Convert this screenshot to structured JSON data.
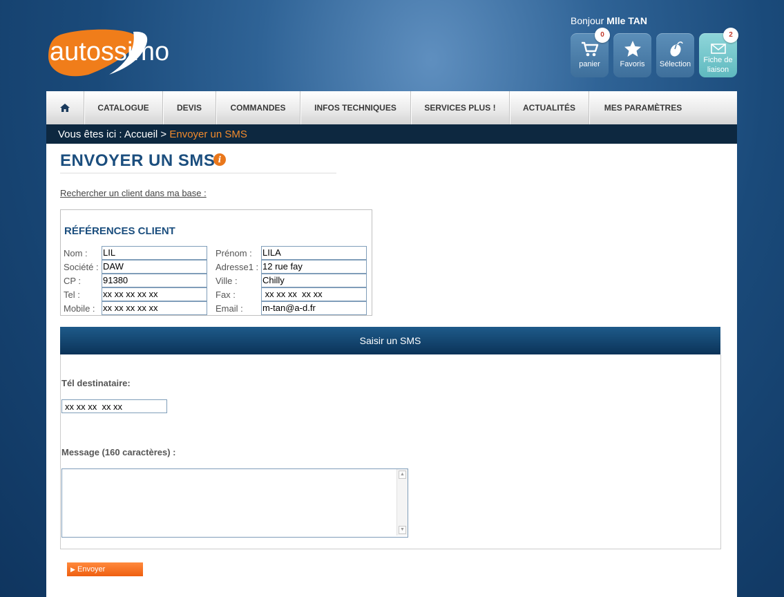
{
  "brand": {
    "logo_text": "autossimo",
    "logo_color": "#f07d1a"
  },
  "header": {
    "greeting_prefix": "Bonjour",
    "user_name": "Mlle TAN",
    "buttons": [
      {
        "label": "panier",
        "icon": "cart-icon",
        "badge": "0"
      },
      {
        "label": "Favoris",
        "icon": "star-icon"
      },
      {
        "label": "Sélection",
        "icon": "mouse-icon"
      },
      {
        "label": "Fiche de liaison",
        "icon": "envelope-icon",
        "badge": "2"
      }
    ]
  },
  "nav": {
    "home_icon": "home-icon",
    "items": [
      "CATALOGUE",
      "DEVIS",
      "COMMANDES",
      "INFOS TECHNIQUES",
      "SERVICES PLUS !",
      "ACTUALITÉS",
      "MES PARAMÈTRES"
    ]
  },
  "breadcrumb": {
    "prefix": "Vous êtes ici : Accueil >",
    "current": "Envoyer un SMS"
  },
  "page": {
    "title": "ENVOYER UN SMS",
    "info_icon": "info-icon",
    "search_link": "Rechercher un client dans ma base :"
  },
  "client": {
    "title": "RÉFÉRENCES CLIENT",
    "fields": {
      "nom": {
        "label": "Nom :",
        "value": "LIL"
      },
      "prenom": {
        "label": "Prénom :",
        "value": "LILA"
      },
      "societe": {
        "label": "Société :",
        "value": "DAW"
      },
      "adresse": {
        "label": "Adresse1 :",
        "value": "12 rue fay"
      },
      "cp": {
        "label": "CP :",
        "value": "91380"
      },
      "ville": {
        "label": "Ville :",
        "value": "Chilly"
      },
      "tel": {
        "label": "Tel :",
        "value": "xx xx xx  xx xx"
      },
      "fax": {
        "label": "Fax :",
        "value": " xx xx xx  xx xx"
      },
      "mobile": {
        "label": "Mobile :",
        "value": "xx xx xx  xx xx"
      },
      "email": {
        "label": "Email :",
        "value": "m-tan@a-d.fr"
      }
    }
  },
  "sms": {
    "section_title": "Saisir un SMS",
    "recipient_label": "Tél destinataire:",
    "recipient_value": "xx xx xx  xx xx",
    "message_label": "Message (160 caractères) :",
    "message_value": "",
    "send_label": "Envoyer"
  }
}
